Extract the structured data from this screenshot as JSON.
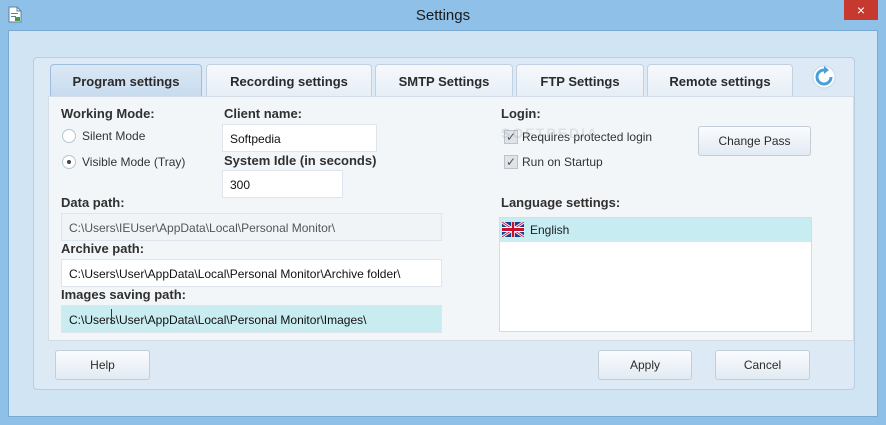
{
  "window": {
    "title": "Settings",
    "close_symbol": "×"
  },
  "tabs": [
    {
      "label": "Program settings"
    },
    {
      "label": "Recording settings"
    },
    {
      "label": "SMTP Settings"
    },
    {
      "label": "FTP Settings"
    },
    {
      "label": "Remote settings"
    }
  ],
  "working_mode": {
    "label": "Working Mode:",
    "options": [
      {
        "label": "Silent Mode",
        "selected": false
      },
      {
        "label": "Visible Mode (Tray)",
        "selected": true
      }
    ]
  },
  "client": {
    "label": "Client name:",
    "value": "Softpedia"
  },
  "idle": {
    "label": "System Idle (in seconds)",
    "value": "300"
  },
  "login": {
    "label": "Login:",
    "options": [
      {
        "label": "Requires protected login",
        "checked": true
      },
      {
        "label": "Run on Startup",
        "checked": true
      }
    ],
    "change_pass_label": "Change Pass"
  },
  "data_path": {
    "label": "Data path:",
    "value": "C:\\Users\\IEUser\\AppData\\Local\\Personal Monitor\\"
  },
  "archive_path": {
    "label": "Archive path:",
    "value": "C:\\Users\\User\\AppData\\Local\\Personal Monitor\\Archive folder\\"
  },
  "images_path": {
    "label": "Images saving path:",
    "value": "C:\\Users\\User\\AppData\\Local\\Personal Monitor\\Images\\"
  },
  "language": {
    "label": "Language settings:",
    "items": [
      {
        "label": "English",
        "flag": "uk-flag-icon"
      }
    ]
  },
  "watermark": "SOFTPEDIA",
  "footer": {
    "help_label": "Help",
    "apply_label": "Apply",
    "cancel_label": "Cancel"
  },
  "colors": {
    "frame": "#8fc1e8",
    "close": "#c7392f",
    "highlight": "#c7ecf2"
  }
}
